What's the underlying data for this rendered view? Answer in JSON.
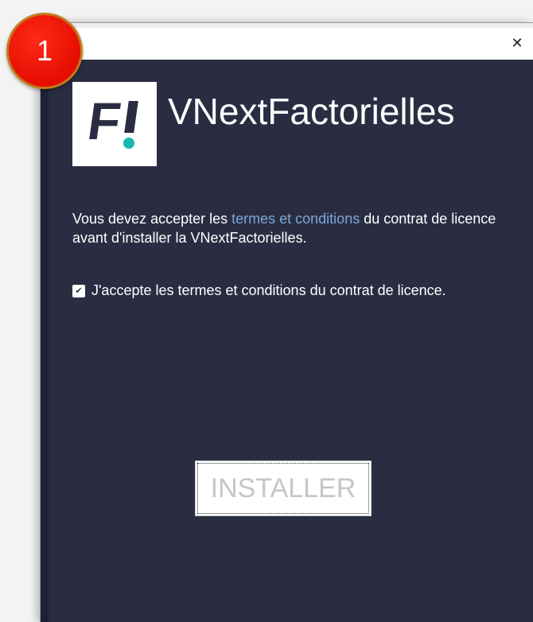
{
  "step_badge": "1",
  "window": {
    "close_icon": "close-icon",
    "close_glyph": "✕"
  },
  "app": {
    "title": "VNextFactorielles",
    "logo_letter": "F",
    "logo_colors": {
      "background": "#ffffff",
      "letter": "#2a2d42",
      "dot": "#18b8b0"
    }
  },
  "license": {
    "text_before": "Vous devez accepter les ",
    "link_text": "termes et conditions",
    "text_after": " du contrat de licence avant d'installer la VNextFactorielles."
  },
  "accept": {
    "checked": true,
    "check_glyph": "✔",
    "label": "J'accepte les termes et conditions du contrat de licence."
  },
  "install_button": {
    "label": "INSTALLER"
  },
  "colors": {
    "window_background": "#2a2d42",
    "link": "#7ba7d9",
    "badge": "#e50d00"
  }
}
